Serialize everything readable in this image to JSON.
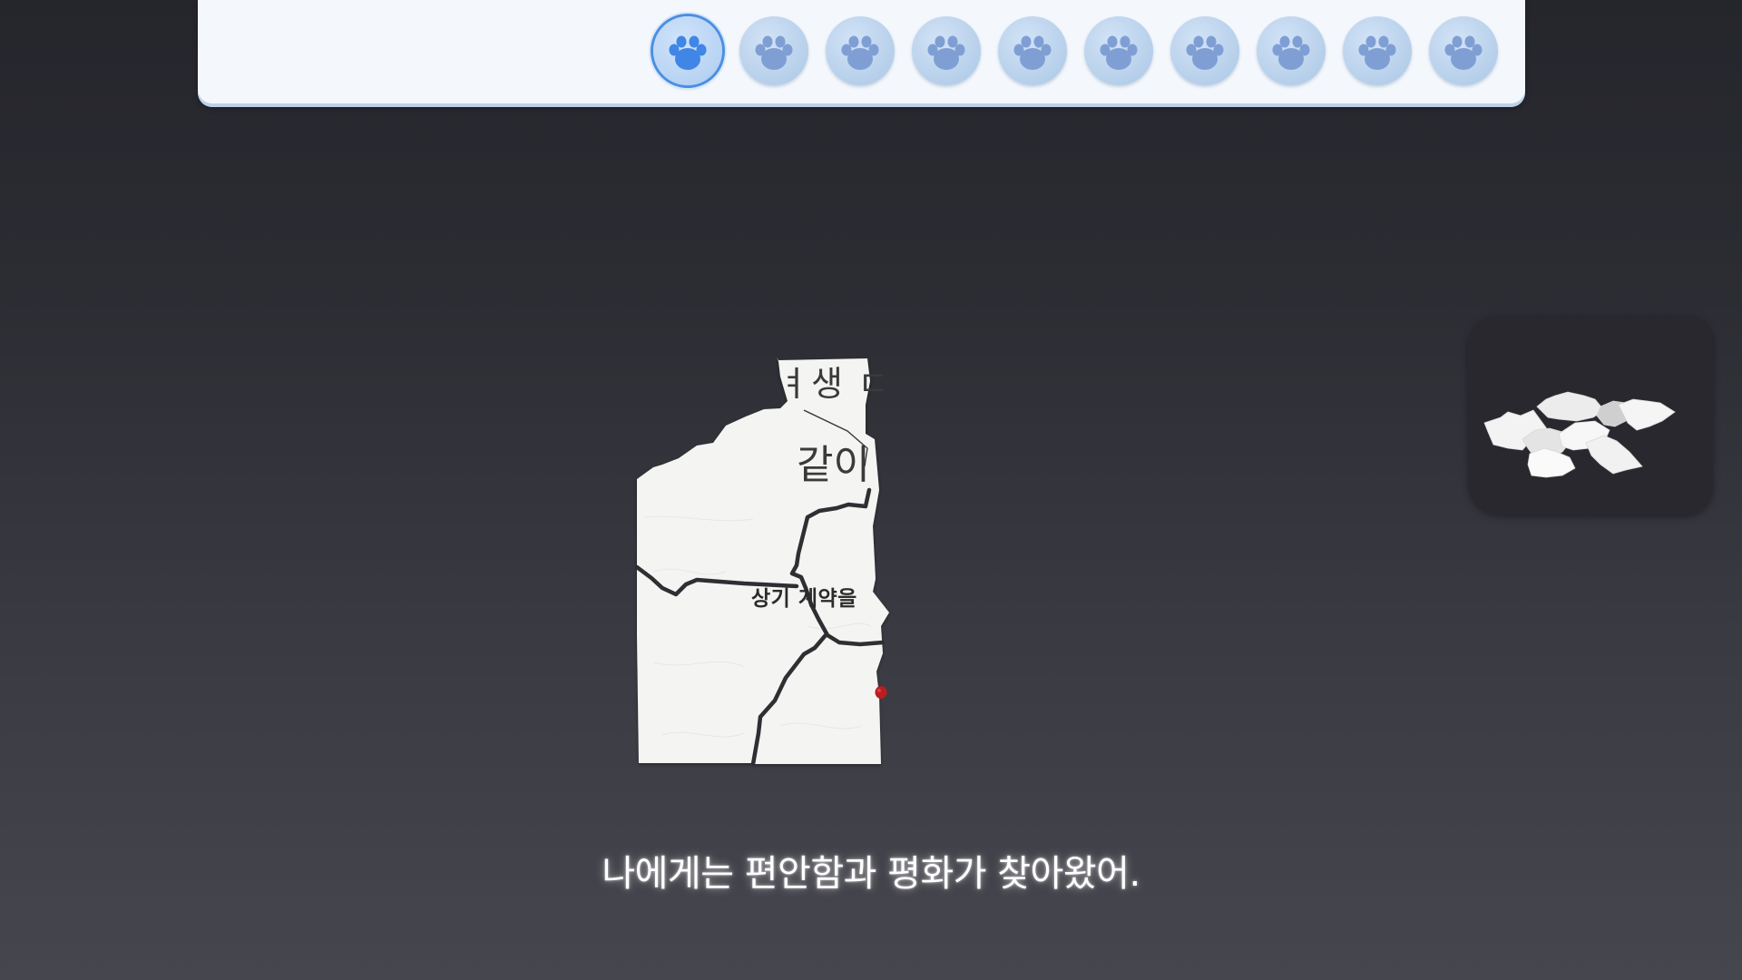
{
  "progress": {
    "total_stages": 10,
    "current_stage": 1,
    "token_icon": "paw-icon",
    "active_color": "#4b8fe2",
    "inactive_color": "#b6cfea",
    "paw_color": "#7f9fd4",
    "active_paw_color": "#3f86e6"
  },
  "puzzle": {
    "fragments": [
      "ㅕ생 ㄷ",
      "같이",
      "상기 계약을"
    ]
  },
  "subtitle": "나에게는 편안함과 평화가 찾아왔어."
}
